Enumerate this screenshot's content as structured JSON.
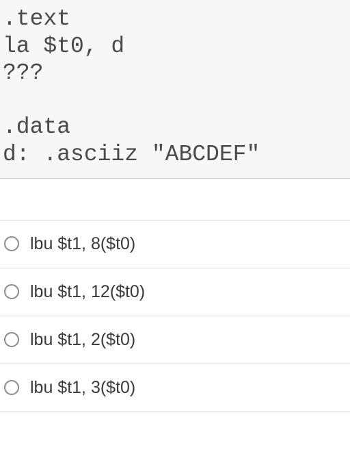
{
  "code": {
    "line1": ".text",
    "line2": "la $t0, d",
    "line3": "???",
    "line4": "",
    "line5": ".data",
    "line6": "d: .asciiz \"ABCDEF\""
  },
  "options": [
    {
      "label": "lbu $t1, 8($t0)"
    },
    {
      "label": "lbu $t1, 12($t0)"
    },
    {
      "label": "lbu $t1, 2($t0)"
    },
    {
      "label": "lbu $t1, 3($t0)"
    }
  ]
}
